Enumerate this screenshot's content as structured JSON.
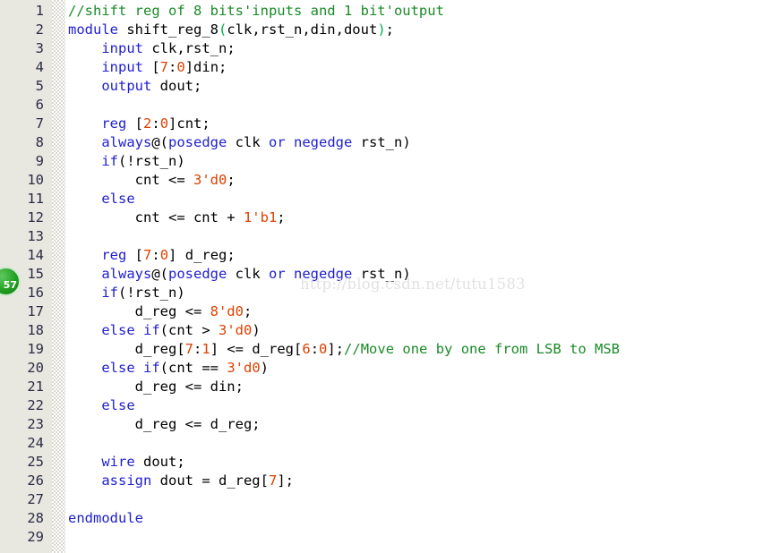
{
  "editor": {
    "language": "Verilog",
    "file_kind": "source-code-view",
    "total_lines": 29,
    "colors": {
      "background": "#ffffff",
      "gutter_background": "#e8e8e0",
      "line_number": "#2b2b44",
      "keyword": "#2020d0",
      "comment": "#1a8a28",
      "number": "#e04000",
      "plain": "#000000",
      "bracket_match": "#00b050",
      "watermark": "#e2e2e2",
      "badge": "#24a024"
    }
  },
  "gutter": {
    "line_numbers": [
      "1",
      "2",
      "3",
      "4",
      "5",
      "6",
      "7",
      "8",
      "9",
      "10",
      "11",
      "12",
      "13",
      "14",
      "15",
      "16",
      "17",
      "18",
      "19",
      "20",
      "21",
      "22",
      "23",
      "24",
      "25",
      "26",
      "27",
      "28",
      "29"
    ]
  },
  "bookmark_badge": {
    "label": "57",
    "line": 15,
    "shape": "circle"
  },
  "watermark": {
    "text": "http://blog.csdn.net/tutu1583"
  },
  "code": {
    "lines": [
      {
        "n": "1",
        "tokens": [
          {
            "t": "//shift reg of 8 bits'inputs and 1 bit'output",
            "c": "cm"
          }
        ]
      },
      {
        "n": "2",
        "tokens": [
          {
            "t": "module",
            "c": "kw"
          },
          {
            "t": " shift_reg_8",
            "c": "pl"
          },
          {
            "t": "(",
            "c": "br"
          },
          {
            "t": "clk,rst_n,din,dout",
            "c": "pl"
          },
          {
            "t": ")",
            "c": "br"
          },
          {
            "t": ";",
            "c": "pl"
          }
        ]
      },
      {
        "n": "3",
        "tokens": [
          {
            "t": "    ",
            "c": "pl"
          },
          {
            "t": "input",
            "c": "kw"
          },
          {
            "t": " clk,rst_n;",
            "c": "pl"
          }
        ]
      },
      {
        "n": "4",
        "tokens": [
          {
            "t": "    ",
            "c": "pl"
          },
          {
            "t": "input",
            "c": "kw"
          },
          {
            "t": " [",
            "c": "pl"
          },
          {
            "t": "7",
            "c": "num"
          },
          {
            "t": ":",
            "c": "pl"
          },
          {
            "t": "0",
            "c": "num"
          },
          {
            "t": "]din;",
            "c": "pl"
          }
        ]
      },
      {
        "n": "5",
        "tokens": [
          {
            "t": "    ",
            "c": "pl"
          },
          {
            "t": "output",
            "c": "kw"
          },
          {
            "t": " dout;",
            "c": "pl"
          }
        ]
      },
      {
        "n": "6",
        "tokens": [
          {
            "t": "",
            "c": "pl"
          }
        ]
      },
      {
        "n": "7",
        "tokens": [
          {
            "t": "    ",
            "c": "pl"
          },
          {
            "t": "reg",
            "c": "kw"
          },
          {
            "t": " [",
            "c": "pl"
          },
          {
            "t": "2",
            "c": "num"
          },
          {
            "t": ":",
            "c": "pl"
          },
          {
            "t": "0",
            "c": "num"
          },
          {
            "t": "]cnt;",
            "c": "pl"
          }
        ]
      },
      {
        "n": "8",
        "tokens": [
          {
            "t": "    ",
            "c": "pl"
          },
          {
            "t": "always",
            "c": "kw"
          },
          {
            "t": "@(",
            "c": "pl"
          },
          {
            "t": "posedge",
            "c": "kw"
          },
          {
            "t": " clk ",
            "c": "pl"
          },
          {
            "t": "or",
            "c": "kw"
          },
          {
            "t": " ",
            "c": "pl"
          },
          {
            "t": "negedge",
            "c": "kw"
          },
          {
            "t": " rst_n)",
            "c": "pl"
          }
        ]
      },
      {
        "n": "9",
        "tokens": [
          {
            "t": "    ",
            "c": "pl"
          },
          {
            "t": "if",
            "c": "kw"
          },
          {
            "t": "(!rst_n)",
            "c": "pl"
          }
        ]
      },
      {
        "n": "10",
        "tokens": [
          {
            "t": "        cnt <= ",
            "c": "pl"
          },
          {
            "t": "3'd0",
            "c": "num"
          },
          {
            "t": ";",
            "c": "pl"
          }
        ]
      },
      {
        "n": "11",
        "tokens": [
          {
            "t": "    ",
            "c": "pl"
          },
          {
            "t": "else",
            "c": "kw"
          }
        ]
      },
      {
        "n": "12",
        "tokens": [
          {
            "t": "        cnt <= cnt + ",
            "c": "pl"
          },
          {
            "t": "1'b1",
            "c": "num"
          },
          {
            "t": ";",
            "c": "pl"
          }
        ]
      },
      {
        "n": "13",
        "tokens": [
          {
            "t": "",
            "c": "pl"
          }
        ]
      },
      {
        "n": "14",
        "tokens": [
          {
            "t": "    ",
            "c": "pl"
          },
          {
            "t": "reg",
            "c": "kw"
          },
          {
            "t": " [",
            "c": "pl"
          },
          {
            "t": "7",
            "c": "num"
          },
          {
            "t": ":",
            "c": "pl"
          },
          {
            "t": "0",
            "c": "num"
          },
          {
            "t": "] d_reg;",
            "c": "pl"
          }
        ]
      },
      {
        "n": "15",
        "tokens": [
          {
            "t": "    ",
            "c": "pl"
          },
          {
            "t": "always",
            "c": "kw"
          },
          {
            "t": "@(",
            "c": "pl"
          },
          {
            "t": "posedge",
            "c": "kw"
          },
          {
            "t": " clk ",
            "c": "pl"
          },
          {
            "t": "or",
            "c": "kw"
          },
          {
            "t": " ",
            "c": "pl"
          },
          {
            "t": "negedge",
            "c": "kw"
          },
          {
            "t": " rst_n)",
            "c": "pl"
          }
        ]
      },
      {
        "n": "16",
        "tokens": [
          {
            "t": "    ",
            "c": "pl"
          },
          {
            "t": "if",
            "c": "kw"
          },
          {
            "t": "(!rst_n)",
            "c": "pl"
          }
        ]
      },
      {
        "n": "17",
        "tokens": [
          {
            "t": "        d_reg <= ",
            "c": "pl"
          },
          {
            "t": "8'd0",
            "c": "num"
          },
          {
            "t": ";",
            "c": "pl"
          }
        ]
      },
      {
        "n": "18",
        "tokens": [
          {
            "t": "    ",
            "c": "pl"
          },
          {
            "t": "else",
            "c": "kw"
          },
          {
            "t": " ",
            "c": "pl"
          },
          {
            "t": "if",
            "c": "kw"
          },
          {
            "t": "(cnt > ",
            "c": "pl"
          },
          {
            "t": "3'd0",
            "c": "num"
          },
          {
            "t": ")",
            "c": "pl"
          }
        ]
      },
      {
        "n": "19",
        "tokens": [
          {
            "t": "        d_reg[",
            "c": "pl"
          },
          {
            "t": "7",
            "c": "num"
          },
          {
            "t": ":",
            "c": "pl"
          },
          {
            "t": "1",
            "c": "num"
          },
          {
            "t": "] <= d_reg[",
            "c": "pl"
          },
          {
            "t": "6",
            "c": "num"
          },
          {
            "t": ":",
            "c": "pl"
          },
          {
            "t": "0",
            "c": "num"
          },
          {
            "t": "];",
            "c": "pl"
          },
          {
            "t": "//Move one by one from LSB to MSB",
            "c": "cm"
          }
        ]
      },
      {
        "n": "20",
        "tokens": [
          {
            "t": "    ",
            "c": "pl"
          },
          {
            "t": "else",
            "c": "kw"
          },
          {
            "t": " ",
            "c": "pl"
          },
          {
            "t": "if",
            "c": "kw"
          },
          {
            "t": "(cnt == ",
            "c": "pl"
          },
          {
            "t": "3'd0",
            "c": "num"
          },
          {
            "t": ")",
            "c": "pl"
          }
        ]
      },
      {
        "n": "21",
        "tokens": [
          {
            "t": "        d_reg <= din;",
            "c": "pl"
          }
        ]
      },
      {
        "n": "22",
        "tokens": [
          {
            "t": "    ",
            "c": "pl"
          },
          {
            "t": "else",
            "c": "kw"
          }
        ]
      },
      {
        "n": "23",
        "tokens": [
          {
            "t": "        d_reg <= d_reg;",
            "c": "pl"
          }
        ]
      },
      {
        "n": "24",
        "tokens": [
          {
            "t": "",
            "c": "pl"
          }
        ]
      },
      {
        "n": "25",
        "tokens": [
          {
            "t": "    ",
            "c": "pl"
          },
          {
            "t": "wire",
            "c": "kw"
          },
          {
            "t": " dout;",
            "c": "pl"
          }
        ]
      },
      {
        "n": "26",
        "tokens": [
          {
            "t": "    ",
            "c": "pl"
          },
          {
            "t": "assign",
            "c": "kw"
          },
          {
            "t": " dout = d_reg[",
            "c": "pl"
          },
          {
            "t": "7",
            "c": "num"
          },
          {
            "t": "];",
            "c": "pl"
          }
        ]
      },
      {
        "n": "27",
        "tokens": [
          {
            "t": "",
            "c": "pl"
          }
        ]
      },
      {
        "n": "28",
        "tokens": [
          {
            "t": "endmodule",
            "c": "kw"
          }
        ]
      },
      {
        "n": "29",
        "tokens": [
          {
            "t": "",
            "c": "pl"
          }
        ]
      }
    ]
  }
}
